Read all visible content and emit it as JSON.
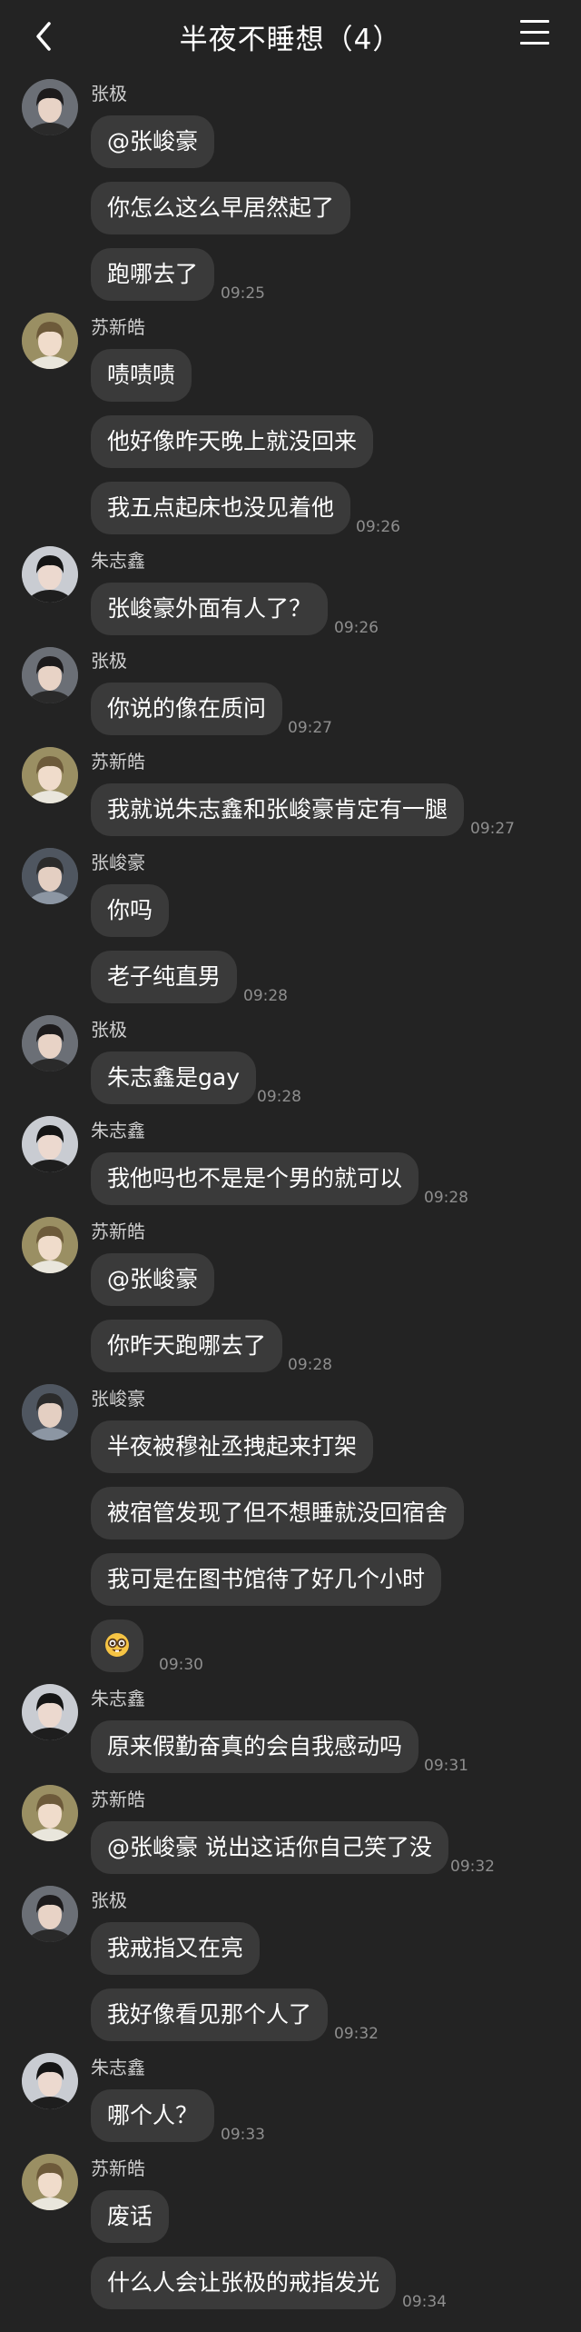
{
  "header": {
    "title": "半夜不睡想（4）"
  },
  "groups": [
    {
      "sender": "张极",
      "avatar": "zhangji",
      "messages": [
        "@张峻豪",
        "你怎么这么早居然起了",
        "跑哪去了"
      ],
      "time": "09:25"
    },
    {
      "sender": "苏新皓",
      "avatar": "suxinhao",
      "messages": [
        "啧啧啧",
        "他好像昨天晚上就没回来",
        "我五点起床也没见着他"
      ],
      "time": "09:26"
    },
    {
      "sender": "朱志鑫",
      "avatar": "zhuzhixin",
      "messages": [
        "张峻豪外面有人了？"
      ],
      "time": "09:26"
    },
    {
      "sender": "张极",
      "avatar": "zhangji",
      "messages": [
        "你说的像在质问"
      ],
      "time": "09:27"
    },
    {
      "sender": "苏新皓",
      "avatar": "suxinhao",
      "messages": [
        "我就说朱志鑫和张峻豪肯定有一腿"
      ],
      "time": "09:27"
    },
    {
      "sender": "张峻豪",
      "avatar": "zhangjunhao",
      "messages": [
        "你吗",
        "老子纯直男"
      ],
      "time": "09:28"
    },
    {
      "sender": "张极",
      "avatar": "zhangji",
      "messages": [
        "朱志鑫是gay"
      ],
      "time": "09:28"
    },
    {
      "sender": "朱志鑫",
      "avatar": "zhuzhixin",
      "messages": [
        "我他吗也不是是个男的就可以"
      ],
      "time": "09:28"
    },
    {
      "sender": "苏新皓",
      "avatar": "suxinhao",
      "messages": [
        "@张峻豪",
        "你昨天跑哪去了"
      ],
      "time": "09:28"
    },
    {
      "sender": "张峻豪",
      "avatar": "zhangjunhao",
      "messages": [
        "半夜被穆祉丞拽起来打架",
        "被宿管发现了但不想睡就没回宿舍",
        "我可是在图书馆待了好几个小时",
        "nerd-face-emoji"
      ],
      "time": "09:30"
    },
    {
      "sender": "朱志鑫",
      "avatar": "zhuzhixin",
      "messages": [
        "原来假勤奋真的会自我感动吗"
      ],
      "time": "09:31"
    },
    {
      "sender": "苏新皓",
      "avatar": "suxinhao",
      "messages": [
        "@张峻豪 说出这话你自己笑了没"
      ],
      "time": "09:32"
    },
    {
      "sender": "张极",
      "avatar": "zhangji",
      "messages": [
        "我戒指又在亮",
        "我好像看见那个人了"
      ],
      "time": "09:32"
    },
    {
      "sender": "朱志鑫",
      "avatar": "zhuzhixin",
      "messages": [
        "哪个人？"
      ],
      "time": "09:33"
    },
    {
      "sender": "苏新皓",
      "avatar": "suxinhao",
      "messages": [
        "废话",
        "什么人会让张极的戒指发光"
      ],
      "time": "09:34"
    }
  ],
  "colors": {
    "background": "#232323",
    "bubble": "#3a3a3a",
    "time": "#8e8e8e",
    "sender": "#cfcfcf"
  }
}
